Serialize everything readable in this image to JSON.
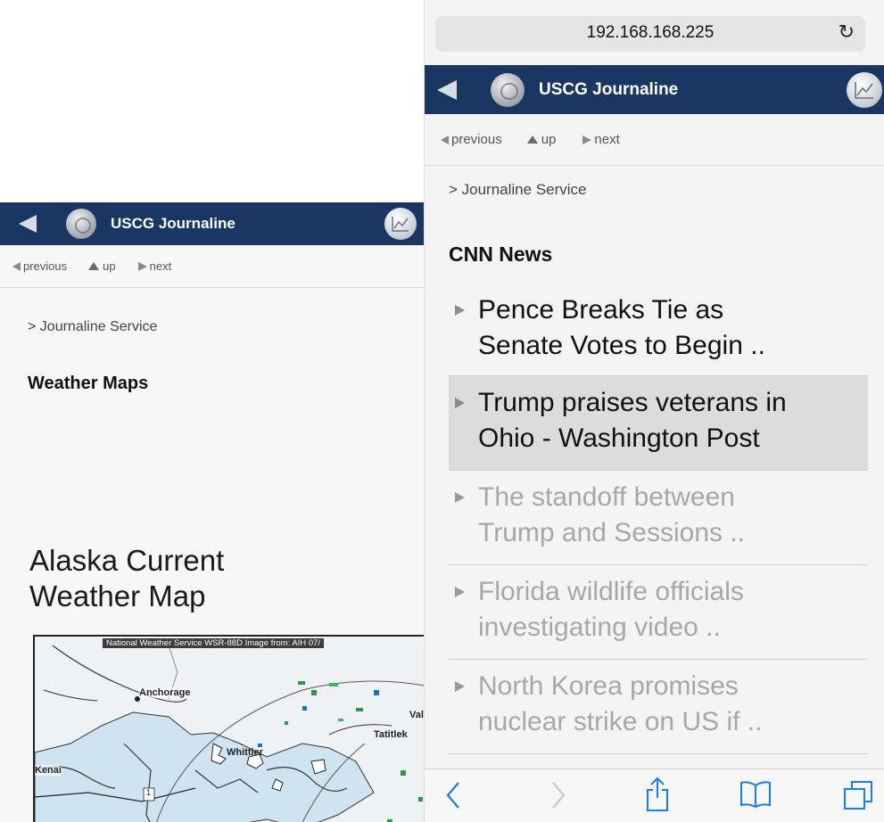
{
  "left": {
    "header": {
      "title": "USCG Journaline"
    },
    "nav": {
      "previous": "previous",
      "up": "up",
      "next": "next"
    },
    "breadcrumb": "> Journaline Service",
    "page_title": "Weather Maps",
    "map": {
      "title_line1": "Alaska Current",
      "title_line2": "Weather Map",
      "caption": "National Weather Service WSR-88D Image from: AIH 07/",
      "labels": {
        "anchorage": "Anchorage",
        "valdez": "Valdez",
        "tatitlek": "Tatitlek",
        "kenai": "Kenai",
        "whittier": "Whittier",
        "route": "1"
      }
    }
  },
  "right": {
    "browser": {
      "url": "192.168.168.225",
      "reload_icon": "↻"
    },
    "header": {
      "title": "USCG Journaline"
    },
    "nav": {
      "previous": "previous",
      "up": "up",
      "next": "next"
    },
    "breadcrumb": "> Journaline Service",
    "page_title": "CNN News",
    "news": [
      {
        "line1": "Pence Breaks Tie as",
        "line2": "Senate Votes to Begin .."
      },
      {
        "line1": "Trump praises veterans in",
        "line2": "Ohio - Washington Post"
      },
      {
        "line1": "The standoff between",
        "line2": "Trump and Sessions .."
      },
      {
        "line1": "Florida wildlife officials",
        "line2": "investigating video .."
      },
      {
        "line1": "North Korea promises",
        "line2": "nuclear strike on US if .."
      }
    ]
  },
  "colors": {
    "header_bg": "#1a3663",
    "ios_blue": "#1a7cf5",
    "selected_row": "#dcdcdc",
    "dim_text": "#a7a7a7"
  },
  "icons": [
    "back-arrow-icon",
    "uscg-logo-icon",
    "chart-icon",
    "previous-arrow-icon",
    "up-arrow-icon",
    "next-arrow-icon",
    "reload-icon",
    "safari-back-icon",
    "safari-forward-icon",
    "share-icon",
    "bookmarks-icon",
    "tabs-icon"
  ]
}
